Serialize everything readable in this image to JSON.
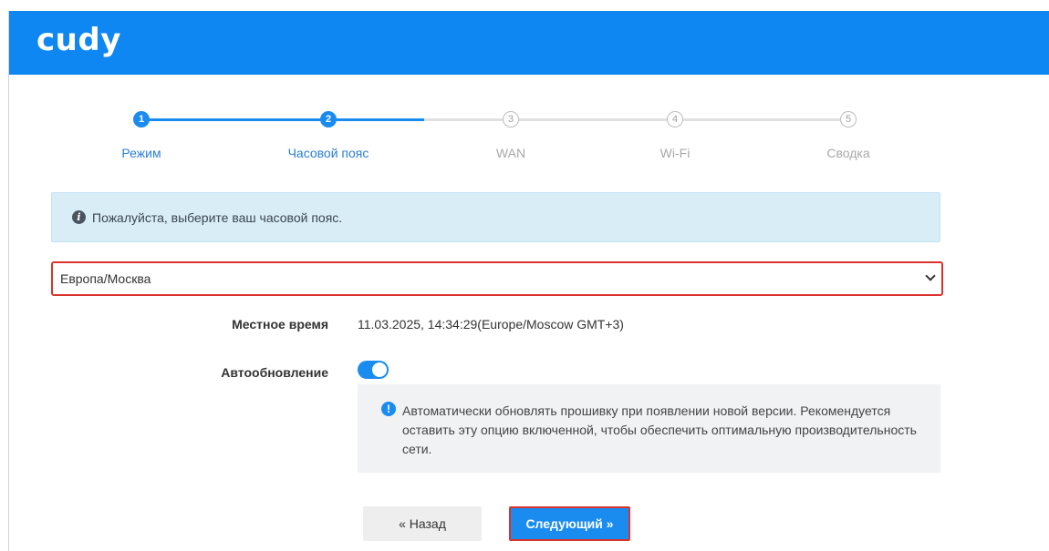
{
  "header": {
    "logo_text": "cudy",
    "background_color": "#0e87f2"
  },
  "stepper": {
    "steps": [
      {
        "number": "1",
        "label": "Режим",
        "state": "complete"
      },
      {
        "number": "2",
        "label": "Часовой пояс",
        "state": "current"
      },
      {
        "number": "3",
        "label": "WAN",
        "state": "pending"
      },
      {
        "number": "4",
        "label": "Wi-Fi",
        "state": "pending"
      },
      {
        "number": "5",
        "label": "Сводка",
        "state": "pending"
      }
    ],
    "active_color": "#1a8cf0"
  },
  "banner": {
    "icon": "info-icon",
    "text": "Пожалуйста, выберите ваш часовой пояс."
  },
  "timezone_select": {
    "value": "Европа/Москва"
  },
  "local_time": {
    "label": "Местное время",
    "value": "11.03.2025, 14:34:29(Europe/Moscow GMT+3)"
  },
  "auto_update": {
    "label": "Автообновление",
    "enabled": true,
    "note_icon": "exclamation-icon",
    "note": "Автоматически обновлять прошивку при появлении новой версии. Рекомендуется оставить эту опцию включенной, чтобы обеспечить оптимальную производительность сети."
  },
  "buttons": {
    "back_label": "« Назад",
    "next_label": "Следующий »"
  },
  "highlight_color": "#d9332c"
}
